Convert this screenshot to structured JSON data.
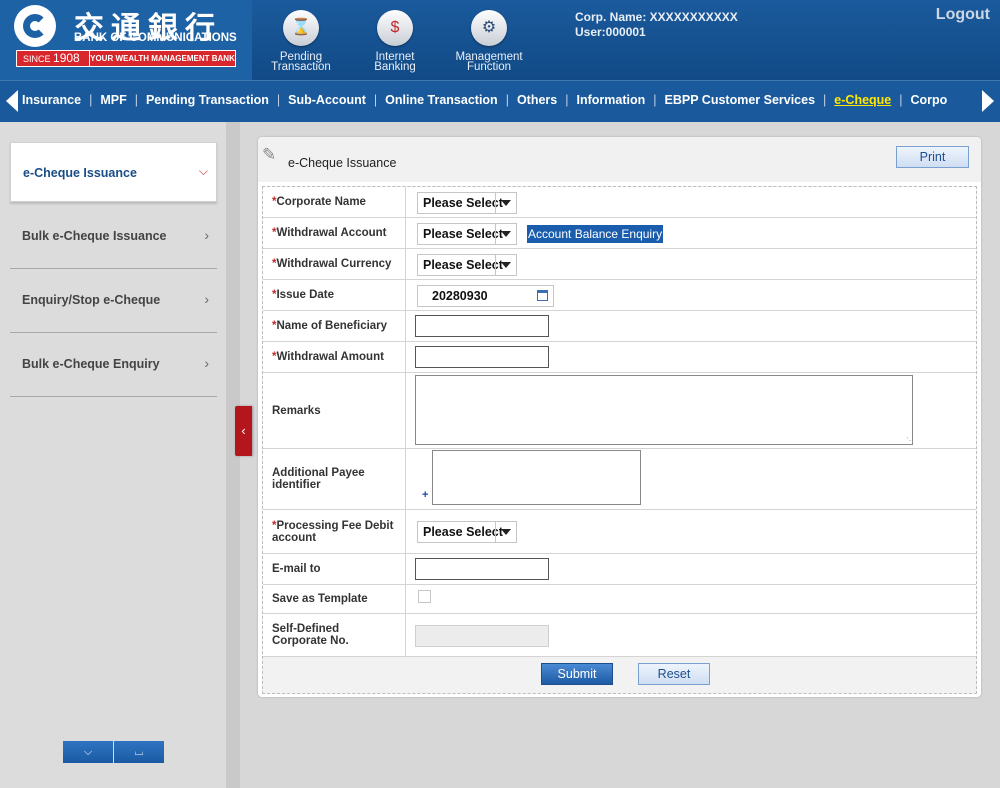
{
  "brand": {
    "name_cn": "交通銀行",
    "name_en": "BANK OF COMMUNICATIONS",
    "since": "SINCE",
    "year": "1908",
    "tagline": "YOUR WEALTH MANAGEMENT BANK",
    "accent_color": "#1a5a9c",
    "red_color": "#d7272d"
  },
  "header": {
    "buttons": [
      {
        "label_1": "Pending",
        "label_2": "Transaction",
        "icon": "hourglass-icon"
      },
      {
        "label_1": "Internet",
        "label_2": "Banking",
        "icon": "monitor-dollar-icon"
      },
      {
        "label_1": "Management",
        "label_2": "Function",
        "icon": "gears-icon"
      }
    ],
    "corp_name": "Corp. Name: XXXXXXXXXXX",
    "user": "User:000001",
    "logout": "Logout"
  },
  "nav": {
    "items": [
      "Insurance",
      "MPF",
      "Pending Transaction",
      "Sub-Account",
      "Online Transaction",
      "Others",
      "Information",
      "EBPP Customer Services",
      "e-Cheque",
      "Corpo"
    ],
    "separator": "|",
    "active": "e-Cheque"
  },
  "sidebar": {
    "active_item": "e-Cheque Issuance",
    "items": [
      "Bulk e-Cheque Issuance",
      "Enquiry/Stop e-Cheque",
      "Bulk e-Cheque Enquiry"
    ]
  },
  "panel": {
    "title": "e-Cheque Issuance",
    "print": "Print"
  },
  "form": {
    "required_mark": "*",
    "corporate_name": {
      "label": "Corporate Name",
      "value": "Please Select"
    },
    "withdrawal_account": {
      "label": "Withdrawal Account",
      "value": "Please Select",
      "link": "Account Balance Enquiry"
    },
    "withdrawal_currency": {
      "label": "Withdrawal Currency",
      "value": "Please Select"
    },
    "issue_date": {
      "label": "Issue Date",
      "value": "20280930"
    },
    "beneficiary": {
      "label": "Name of Beneficiary",
      "value": ""
    },
    "amount": {
      "label": "Withdrawal Amount",
      "value": ""
    },
    "remarks": {
      "label": "Remarks",
      "value": ""
    },
    "payee_identifier": {
      "label_1": "Additional Payee",
      "label_2": "identifier",
      "value": "",
      "add": "+"
    },
    "fee_account": {
      "label_1": "Processing Fee Debit",
      "label_2": "account",
      "value": "Please Select"
    },
    "email": {
      "label": "E-mail to",
      "value": ""
    },
    "save_template": {
      "label": "Save as Template",
      "checked": false
    },
    "corporate_no": {
      "label_1": "Self-Defined",
      "label_2": "Corporate No.",
      "value": ""
    },
    "submit": "Submit",
    "reset": "Reset"
  }
}
